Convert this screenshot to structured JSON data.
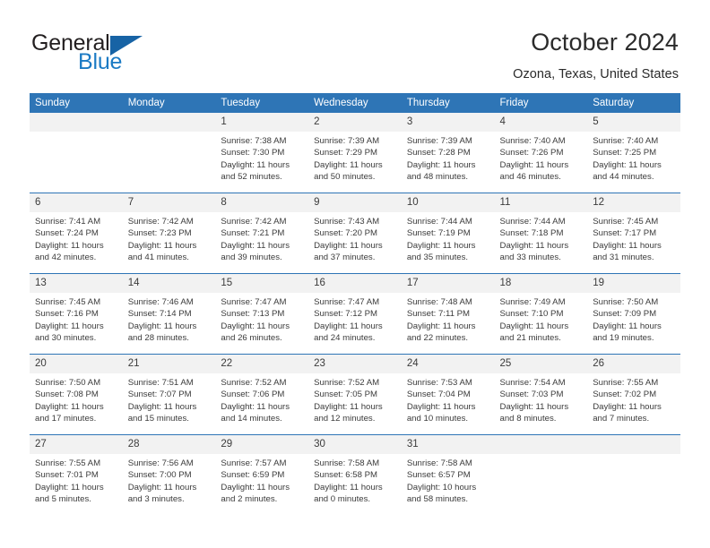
{
  "brand": {
    "name_part1": "General",
    "name_part2": "Blue",
    "triangle_icon": "triangle-icon"
  },
  "header": {
    "title": "October 2024",
    "location": "Ozona, Texas, United States"
  },
  "calendar": {
    "weekday_headers": [
      "Sunday",
      "Monday",
      "Tuesday",
      "Wednesday",
      "Thursday",
      "Friday",
      "Saturday"
    ],
    "accent_color": "#2e75b6",
    "daynum_band_color": "#f2f2f2",
    "weeks": [
      [
        {
          "day": "",
          "blank": true
        },
        {
          "day": "",
          "blank": true
        },
        {
          "day": "1",
          "sunrise": "Sunrise: 7:38 AM",
          "sunset": "Sunset: 7:30 PM",
          "daylight": "Daylight: 11 hours and 52 minutes."
        },
        {
          "day": "2",
          "sunrise": "Sunrise: 7:39 AM",
          "sunset": "Sunset: 7:29 PM",
          "daylight": "Daylight: 11 hours and 50 minutes."
        },
        {
          "day": "3",
          "sunrise": "Sunrise: 7:39 AM",
          "sunset": "Sunset: 7:28 PM",
          "daylight": "Daylight: 11 hours and 48 minutes."
        },
        {
          "day": "4",
          "sunrise": "Sunrise: 7:40 AM",
          "sunset": "Sunset: 7:26 PM",
          "daylight": "Daylight: 11 hours and 46 minutes."
        },
        {
          "day": "5",
          "sunrise": "Sunrise: 7:40 AM",
          "sunset": "Sunset: 7:25 PM",
          "daylight": "Daylight: 11 hours and 44 minutes."
        }
      ],
      [
        {
          "day": "6",
          "sunrise": "Sunrise: 7:41 AM",
          "sunset": "Sunset: 7:24 PM",
          "daylight": "Daylight: 11 hours and 42 minutes."
        },
        {
          "day": "7",
          "sunrise": "Sunrise: 7:42 AM",
          "sunset": "Sunset: 7:23 PM",
          "daylight": "Daylight: 11 hours and 41 minutes."
        },
        {
          "day": "8",
          "sunrise": "Sunrise: 7:42 AM",
          "sunset": "Sunset: 7:21 PM",
          "daylight": "Daylight: 11 hours and 39 minutes."
        },
        {
          "day": "9",
          "sunrise": "Sunrise: 7:43 AM",
          "sunset": "Sunset: 7:20 PM",
          "daylight": "Daylight: 11 hours and 37 minutes."
        },
        {
          "day": "10",
          "sunrise": "Sunrise: 7:44 AM",
          "sunset": "Sunset: 7:19 PM",
          "daylight": "Daylight: 11 hours and 35 minutes."
        },
        {
          "day": "11",
          "sunrise": "Sunrise: 7:44 AM",
          "sunset": "Sunset: 7:18 PM",
          "daylight": "Daylight: 11 hours and 33 minutes."
        },
        {
          "day": "12",
          "sunrise": "Sunrise: 7:45 AM",
          "sunset": "Sunset: 7:17 PM",
          "daylight": "Daylight: 11 hours and 31 minutes."
        }
      ],
      [
        {
          "day": "13",
          "sunrise": "Sunrise: 7:45 AM",
          "sunset": "Sunset: 7:16 PM",
          "daylight": "Daylight: 11 hours and 30 minutes."
        },
        {
          "day": "14",
          "sunrise": "Sunrise: 7:46 AM",
          "sunset": "Sunset: 7:14 PM",
          "daylight": "Daylight: 11 hours and 28 minutes."
        },
        {
          "day": "15",
          "sunrise": "Sunrise: 7:47 AM",
          "sunset": "Sunset: 7:13 PM",
          "daylight": "Daylight: 11 hours and 26 minutes."
        },
        {
          "day": "16",
          "sunrise": "Sunrise: 7:47 AM",
          "sunset": "Sunset: 7:12 PM",
          "daylight": "Daylight: 11 hours and 24 minutes."
        },
        {
          "day": "17",
          "sunrise": "Sunrise: 7:48 AM",
          "sunset": "Sunset: 7:11 PM",
          "daylight": "Daylight: 11 hours and 22 minutes."
        },
        {
          "day": "18",
          "sunrise": "Sunrise: 7:49 AM",
          "sunset": "Sunset: 7:10 PM",
          "daylight": "Daylight: 11 hours and 21 minutes."
        },
        {
          "day": "19",
          "sunrise": "Sunrise: 7:50 AM",
          "sunset": "Sunset: 7:09 PM",
          "daylight": "Daylight: 11 hours and 19 minutes."
        }
      ],
      [
        {
          "day": "20",
          "sunrise": "Sunrise: 7:50 AM",
          "sunset": "Sunset: 7:08 PM",
          "daylight": "Daylight: 11 hours and 17 minutes."
        },
        {
          "day": "21",
          "sunrise": "Sunrise: 7:51 AM",
          "sunset": "Sunset: 7:07 PM",
          "daylight": "Daylight: 11 hours and 15 minutes."
        },
        {
          "day": "22",
          "sunrise": "Sunrise: 7:52 AM",
          "sunset": "Sunset: 7:06 PM",
          "daylight": "Daylight: 11 hours and 14 minutes."
        },
        {
          "day": "23",
          "sunrise": "Sunrise: 7:52 AM",
          "sunset": "Sunset: 7:05 PM",
          "daylight": "Daylight: 11 hours and 12 minutes."
        },
        {
          "day": "24",
          "sunrise": "Sunrise: 7:53 AM",
          "sunset": "Sunset: 7:04 PM",
          "daylight": "Daylight: 11 hours and 10 minutes."
        },
        {
          "day": "25",
          "sunrise": "Sunrise: 7:54 AM",
          "sunset": "Sunset: 7:03 PM",
          "daylight": "Daylight: 11 hours and 8 minutes."
        },
        {
          "day": "26",
          "sunrise": "Sunrise: 7:55 AM",
          "sunset": "Sunset: 7:02 PM",
          "daylight": "Daylight: 11 hours and 7 minutes."
        }
      ],
      [
        {
          "day": "27",
          "sunrise": "Sunrise: 7:55 AM",
          "sunset": "Sunset: 7:01 PM",
          "daylight": "Daylight: 11 hours and 5 minutes."
        },
        {
          "day": "28",
          "sunrise": "Sunrise: 7:56 AM",
          "sunset": "Sunset: 7:00 PM",
          "daylight": "Daylight: 11 hours and 3 minutes."
        },
        {
          "day": "29",
          "sunrise": "Sunrise: 7:57 AM",
          "sunset": "Sunset: 6:59 PM",
          "daylight": "Daylight: 11 hours and 2 minutes."
        },
        {
          "day": "30",
          "sunrise": "Sunrise: 7:58 AM",
          "sunset": "Sunset: 6:58 PM",
          "daylight": "Daylight: 11 hours and 0 minutes."
        },
        {
          "day": "31",
          "sunrise": "Sunrise: 7:58 AM",
          "sunset": "Sunset: 6:57 PM",
          "daylight": "Daylight: 10 hours and 58 minutes."
        },
        {
          "day": "",
          "blank": true
        },
        {
          "day": "",
          "blank": true
        }
      ]
    ]
  }
}
